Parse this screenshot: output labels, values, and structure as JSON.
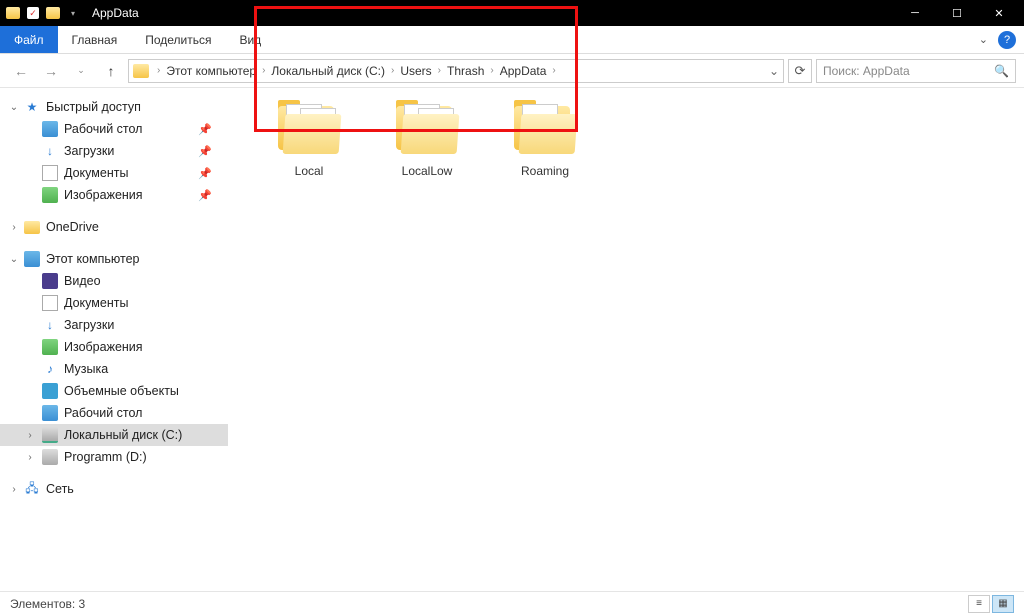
{
  "titlebar": {
    "title": "AppData"
  },
  "ribbon": {
    "file": "Файл",
    "home": "Главная",
    "share": "Поделиться",
    "view": "Вид"
  },
  "breadcrumb": {
    "items": [
      "Этот компьютер",
      "Локальный диск (C:)",
      "Users",
      "Thrash",
      "AppData"
    ]
  },
  "search": {
    "placeholder": "Поиск: AppData"
  },
  "sidebar": {
    "quick_access": "Быстрый доступ",
    "desktop": "Рабочий стол",
    "downloads": "Загрузки",
    "documents": "Документы",
    "pictures": "Изображения",
    "onedrive": "OneDrive",
    "this_pc": "Этот компьютер",
    "video": "Видео",
    "documents2": "Документы",
    "downloads2": "Загрузки",
    "pictures2": "Изображения",
    "music": "Музыка",
    "objects3d": "Объемные объекты",
    "desktop2": "Рабочий стол",
    "local_disk": "Локальный диск (C:)",
    "programm": "Programm (D:)",
    "network": "Сеть"
  },
  "folders": {
    "local": "Local",
    "locallow": "LocalLow",
    "roaming": "Roaming"
  },
  "statusbar": {
    "items": "Элементов: 3"
  }
}
